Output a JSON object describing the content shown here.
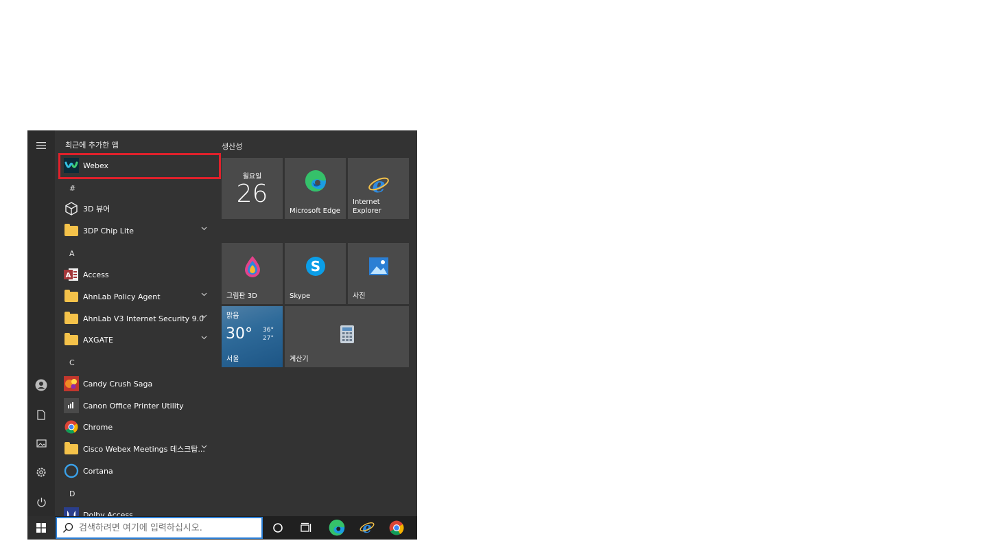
{
  "start_menu": {
    "list_header": "최근에 추가한 앱",
    "apps": [
      {
        "label": "Webex",
        "icon": "webex-icon"
      },
      {
        "group": "#"
      },
      {
        "label": "3D 뷰어",
        "icon": "cube-icon"
      },
      {
        "label": "3DP Chip Lite",
        "icon": "folder-icon",
        "expandable": true
      },
      {
        "group": "A"
      },
      {
        "label": "Access",
        "icon": "access-icon"
      },
      {
        "label": "AhnLab Policy Agent",
        "icon": "folder-icon",
        "expandable": true
      },
      {
        "label": "AhnLab V3 Internet Security 9.0",
        "icon": "folder-icon",
        "expandable": true
      },
      {
        "label": "AXGATE",
        "icon": "folder-icon",
        "expandable": true
      },
      {
        "group": "C"
      },
      {
        "label": "Candy Crush Saga",
        "icon": "candy-crush-icon"
      },
      {
        "label": "Canon Office Printer Utility",
        "icon": "canon-icon"
      },
      {
        "label": "Chrome",
        "icon": "chrome-icon"
      },
      {
        "label": "Cisco Webex Meetings 데스크탑...",
        "icon": "folder-icon",
        "expandable": true
      },
      {
        "label": "Cortana",
        "icon": "cortana-icon"
      },
      {
        "group": "D"
      },
      {
        "label": "Dolby Access",
        "icon": "dolby-icon"
      }
    ],
    "tiles_header": "생산성",
    "tiles": {
      "calendar": {
        "weekday": "월요일",
        "day": "26"
      },
      "edge": "Microsoft Edge",
      "ie": "Internet Explorer",
      "paint3d": "그림판 3D",
      "skype": "Skype",
      "photos": "사진",
      "weather": {
        "condition": "맑음",
        "temp": "30°",
        "high": "36°",
        "low": "27°",
        "city": "서울"
      },
      "calculator": "계산기"
    }
  },
  "taskbar": {
    "search_placeholder": "검색하려면 여기에 입력하십시오."
  },
  "colors": {
    "highlight": "#e0212b",
    "menu_bg": "#333333",
    "tile_bg": "#4a4a4a"
  }
}
